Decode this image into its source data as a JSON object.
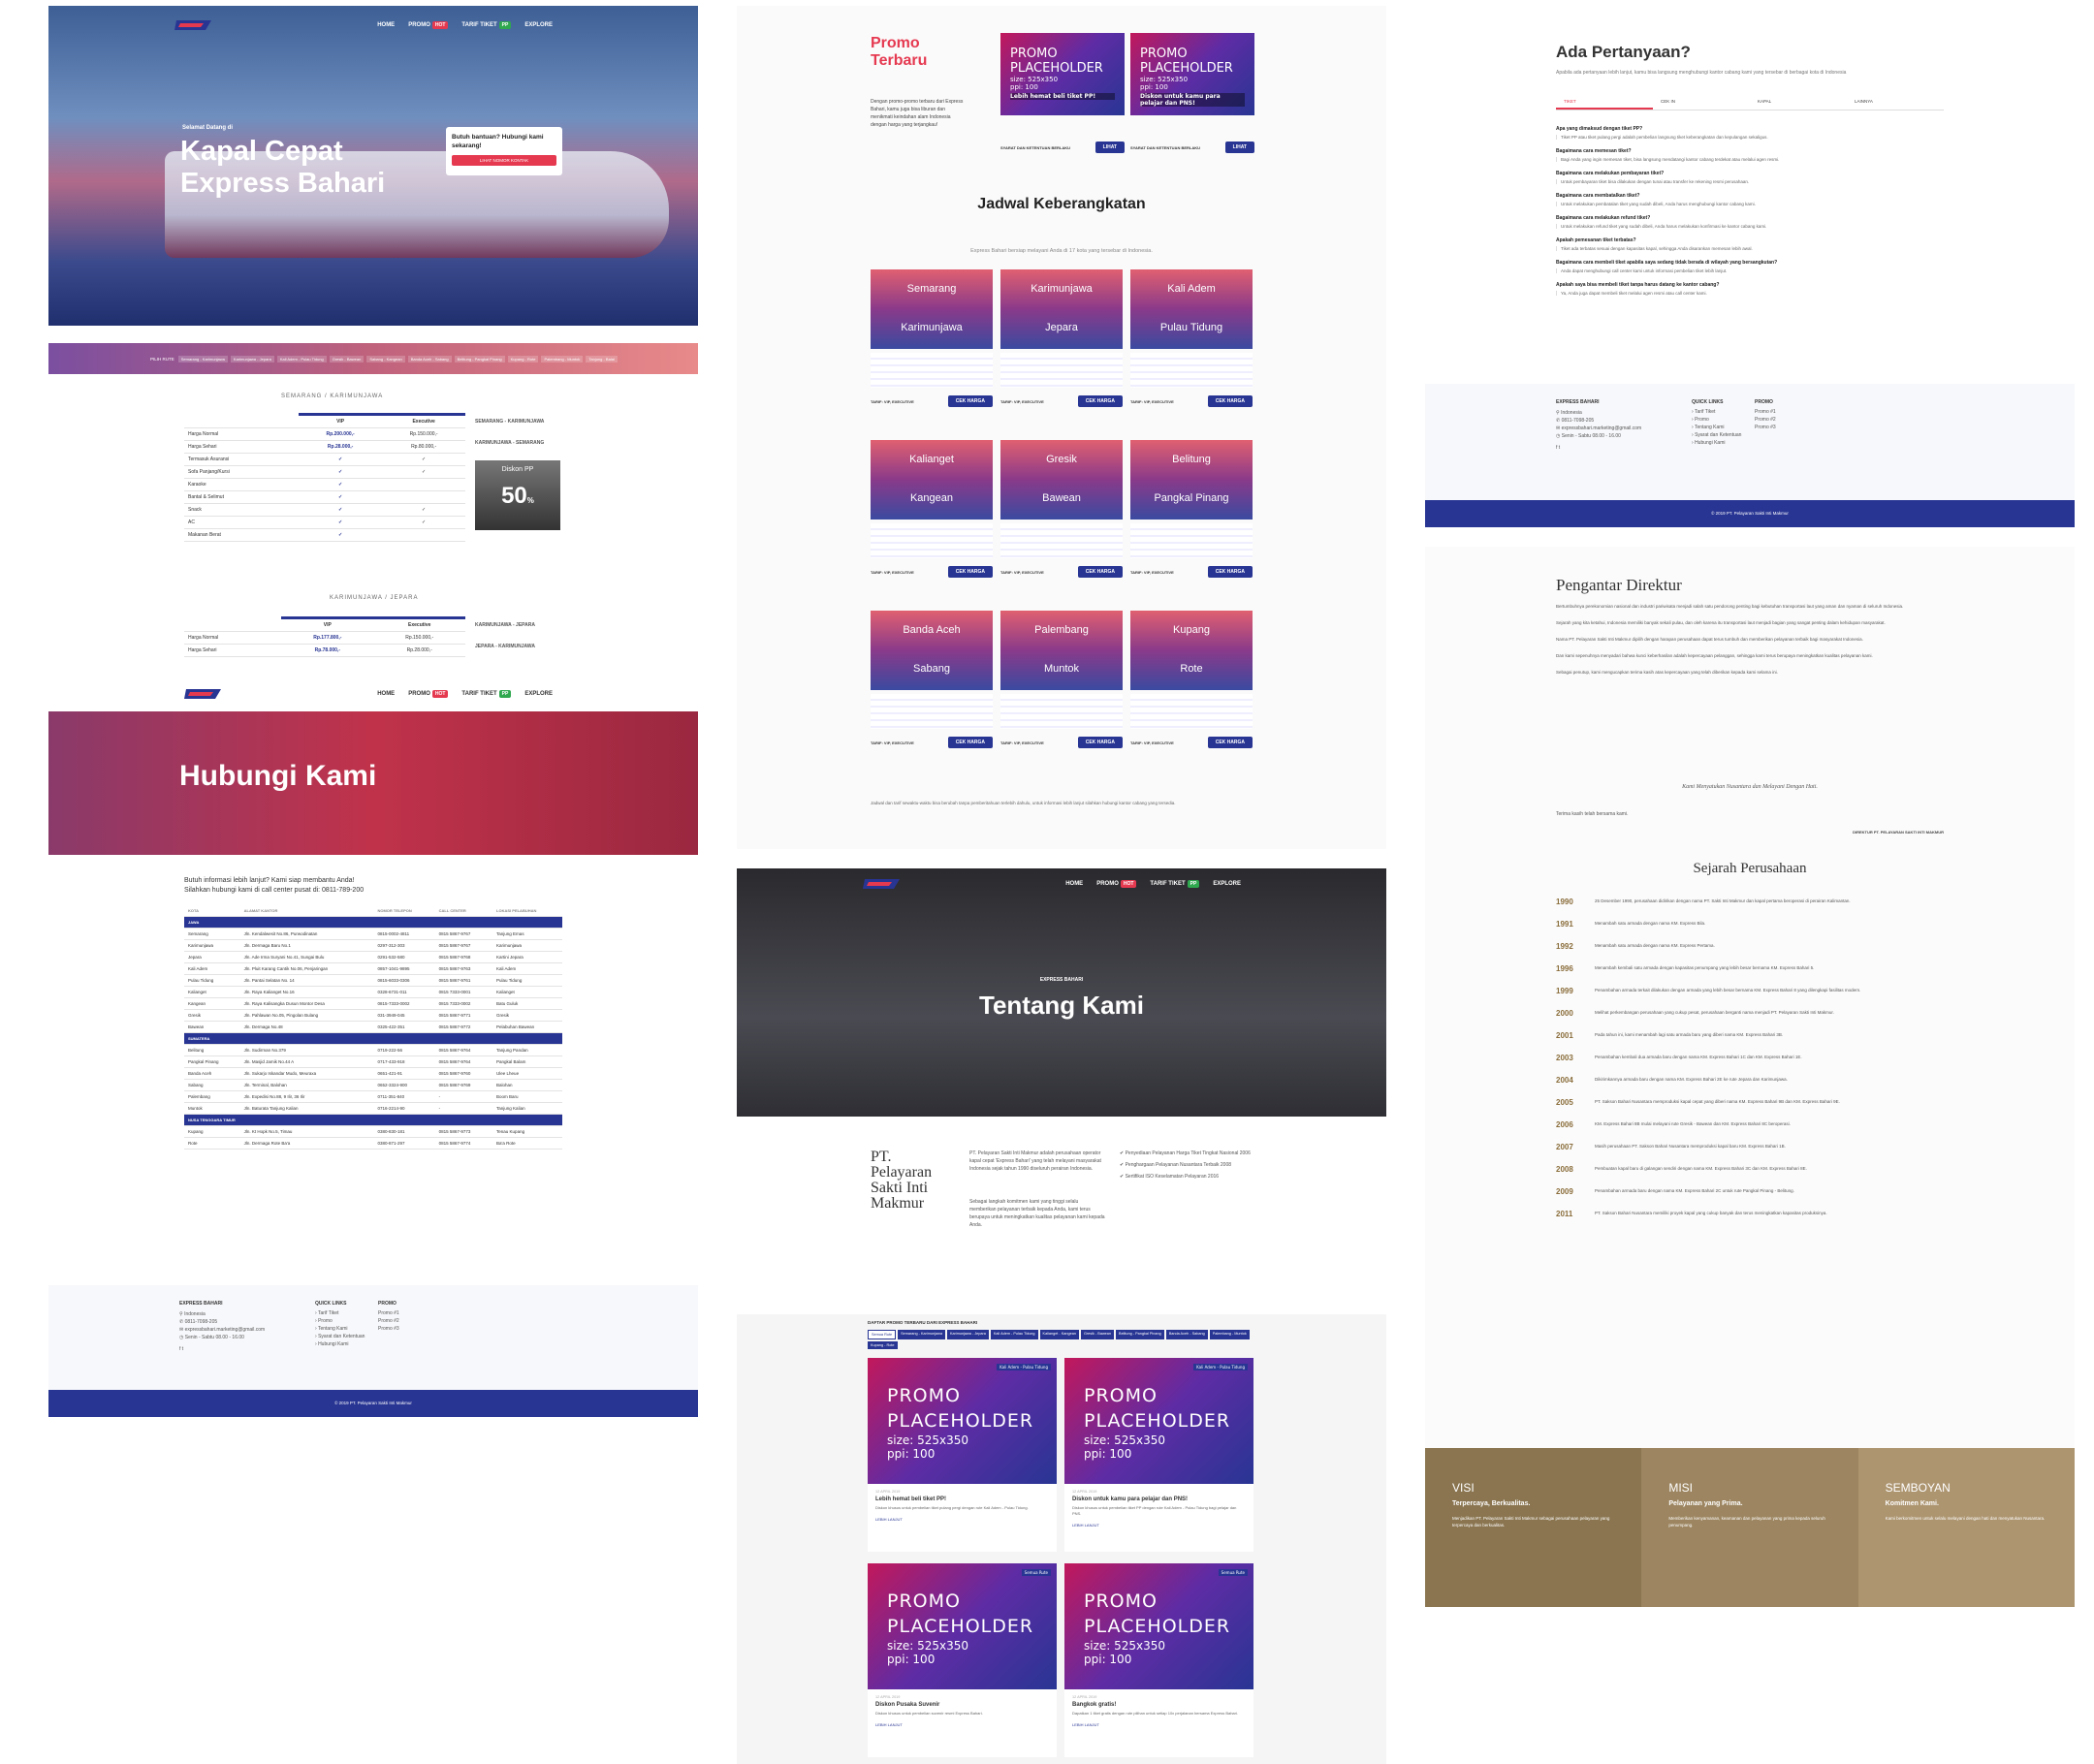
{
  "nav": {
    "home": "HOME",
    "promo": "PROMO",
    "promo_badge": "HOT",
    "tarif": "TARIF TIKET",
    "tarif_badge": "PP",
    "explore": "EXPLORE"
  },
  "hero": {
    "welcome": "Selamat Datang di",
    "title_l1": "Kapal Cepat",
    "title_l2": "Express Bahari",
    "help_title": "Butuh bantuan? Hubungi kami sekarang!",
    "help_button": "LIHAT NOMOR KONTAK"
  },
  "tarif": {
    "filter_label": "PILIH RUTE",
    "route_tabs": [
      "Semarang - Karimunjawa",
      "Karimunjawa - Jepara",
      "Kali Adem - Pulau Tidung",
      "Gresik - Bawean",
      "Sabang - Kangean",
      "Banda Aceh - Sabang",
      "Belitung - Pangkal Pinang",
      "Kupang - Rote",
      "Palembang - Muntok",
      "Tanjung - Balai"
    ],
    "route1_title": "SEMARANG / KARIMUNJAWA",
    "route2_title": "KARIMUNJAWA / JEPARA",
    "col_vip": "VIP",
    "col_exec": "Executive",
    "rows": [
      {
        "label": "Harga Normal",
        "vip": "Rp.200.000,-",
        "exec": "Rp.150.000,-"
      },
      {
        "label": "Harga Sehari",
        "vip": "Rp.28.000,-",
        "exec": "Rp.80.000,-"
      },
      {
        "label": "Termasuk Asuransi",
        "vip": "✓",
        "exec": "✓"
      },
      {
        "label": "Sofa Panjang/Kursi",
        "vip": "✓",
        "exec": "✓"
      },
      {
        "label": "Karaoke",
        "vip": "✓",
        "exec": ""
      },
      {
        "label": "Bantal & Selimut",
        "vip": "✓",
        "exec": ""
      },
      {
        "label": "Snack",
        "vip": "✓",
        "exec": "✓"
      },
      {
        "label": "AC",
        "vip": "✓",
        "exec": "✓"
      },
      {
        "label": "Makanan Berat",
        "vip": "✓",
        "exec": ""
      }
    ],
    "rows2": [
      {
        "label": "Harga Normal",
        "vip": "Rp.177.800,-",
        "exec": "Rp.150.000,-"
      },
      {
        "label": "Harga Sehari",
        "vip": "Rp.78.000,-",
        "exec": "Rp.28.000,-"
      }
    ],
    "side_sched1": "SEMARANG - KARIMUNJAWA",
    "side_sched2": "KARIMUNJAWA - SEMARANG",
    "side_sched3": "KARIMUNJAWA - JEPARA",
    "side_sched4": "JEPARA - KARIMUNJAWA",
    "diskon_title": "Diskon PP",
    "diskon_value": "50",
    "diskon_unit": "%"
  },
  "contact": {
    "title": "Hubungi Kami",
    "intro_l1": "Butuh informasi lebih lanjut? Kami siap membantu Anda!",
    "intro_l2": "Silahkan hubungi kami di call center pusat di: 0811-789-200",
    "headers": [
      "KOTA",
      "ALAMAT KANTOR",
      "NOMOR TELEPON",
      "CALL CENTER",
      "LOKASI PELABUHAN"
    ],
    "group1": "JAWA",
    "group2": "SUMATERA",
    "group3": "NUSA TENGGARA TIMUR",
    "rows_jawa": [
      [
        "Semarang",
        "Jln. Kendalwesit No.86, Purwodinatan",
        "0815-0002-4811",
        "0815 5867-9767",
        "Tanjung Emas"
      ],
      [
        "Karimunjawa",
        "Jln. Dermaga Baru No.1",
        "0297-312-303",
        "0815 5867-9767",
        "Karimunjawa"
      ],
      [
        "Jepara",
        "Jln. Ade Irma Suryani No.41, Sungai Bulu",
        "0291-532-580",
        "0815 5867-9768",
        "Kartini Jepara"
      ],
      [
        "Kali Adem",
        "Jln. Pluit Karang Cantik No.06, Penjaringan",
        "0857-1041-9895",
        "0815 5867-9763",
        "Kali Adem"
      ],
      [
        "Pulau Tidung",
        "Jln. Pantai Selatan No. 14",
        "0815-6033-0306",
        "0815 5867-9761",
        "Pulau Tidung"
      ],
      [
        "Kalianget",
        "Jln. Raya Kalianget No.16",
        "0328-6731-011",
        "0815 7333-0001",
        "Kalianget"
      ],
      [
        "Kangean",
        "Jln. Raya Kalisangka Dusun Montor Desa",
        "0815-7333-0002",
        "0815 7333-0002",
        "Batu Guluk"
      ],
      [
        "Gresik",
        "Jln. Pahlawan No.05, Pingolan Bulang",
        "031-3949-045",
        "0815 5867-9771",
        "Gresik"
      ],
      [
        "Bawean",
        "Jln. Dermaga No.48",
        "0325-422-351",
        "0815 5867-9772",
        "Pelabuhan Bawean"
      ]
    ],
    "rows_sumatera": [
      [
        "Belitung",
        "Jln. Sudirman No.379",
        "0719-222-56",
        "0815 5867-9764",
        "Tanjung Pandan"
      ],
      [
        "Pangkal Pinang",
        "Jln. Masjid Jamik No.44 A",
        "0717-433-918",
        "0815 5867-9764",
        "Pangkal Balam"
      ],
      [
        "Banda Aceh",
        "Jln. Sukarjo Iskandar Mudo, Meuraxa",
        "0651-421-91",
        "0815 5867-9760",
        "Ulee Lheue"
      ],
      [
        "Sabang",
        "Jln. Terminal, Balohan",
        "0652-3324-900",
        "0815 5867-9769",
        "Balohan"
      ],
      [
        "Palembang",
        "Jln. Expedisi No.88, 9 Ilir, 36 Ilir",
        "0711-351-840",
        "-",
        "Boom Baru"
      ],
      [
        "Muntok",
        "Jln. Baturata Tanjung Kalian",
        "0716-2214-90",
        "-",
        "Tanjung Kalian"
      ]
    ],
    "rows_ntt": [
      [
        "Kupang",
        "Jln. Kt Hopk No.5, Timau",
        "0380-830-181",
        "0815 5867-9773",
        "Tenau Kupang"
      ],
      [
        "Rote",
        "Jln. Dermaga Rote Ba'a",
        "0380-871-297",
        "0815 5867-9774",
        "Ba'a Rote"
      ]
    ]
  },
  "footer": {
    "brand": "EXPRESS BAHARI",
    "addr": "Indonesia",
    "phone": "0811-7098-205",
    "email": "expressbahari.marketing@gmail.com",
    "hours": "Senin - Sabtu 08.00 - 16.00",
    "quick_title": "QUICK LINKS",
    "quick_links": [
      "Tarif Tiket",
      "Promo",
      "Tentang Kami",
      "Syarat dan Ketentuan",
      "Hubungi Kami"
    ],
    "promo_title": "PROMO",
    "promo_items": [
      "Promo #1",
      "Promo #2",
      "Promo #3"
    ],
    "copyright": "© 2019 PT. Pelayaran Sakti Inti Makmur"
  },
  "promo_section": {
    "title_l1": "Promo",
    "title_l2": "Terbaru",
    "desc": "Dengan promo-promo terbaru dari Express Bahari, kamu juga bisa liburan dan menikmati keindahan alam Indonesia dengan harga yang terjangkau!",
    "card1_caption": "Lebih hemat beli tiket PP!",
    "card2_caption": "Diskon untuk kamu para pelajar dan PNS!",
    "card_syarat": "SYARAT DAN KETENTUAN BERLAKU",
    "card_btn": "LIHAT"
  },
  "placeholder": {
    "l1": "PROMO",
    "l2": "PLACEHOLDER",
    "l3": "size: 525x350",
    "l4": "ppi: 100"
  },
  "jadwal": {
    "title": "Jadwal Keberangkatan",
    "subtitle": "Express Bahari bersiap melayani Anda di 17 kota yang tersebar di Indonesia.",
    "cek": "CEK HARGA",
    "tarif_label": "TARIF: VIP, EXECUTIVE",
    "routes": [
      [
        "Semarang",
        "Karimunjawa"
      ],
      [
        "Karimunjawa",
        "Jepara"
      ],
      [
        "Kali Adem",
        "Pulau Tidung"
      ],
      [
        "Kalianget",
        "Kangean"
      ],
      [
        "Gresik",
        "Bawean"
      ],
      [
        "Belitung",
        "Pangkal Pinang"
      ],
      [
        "Banda Aceh",
        "Sabang"
      ],
      [
        "Palembang",
        "Muntok"
      ],
      [
        "Kupang",
        "Rote"
      ]
    ],
    "note": "Jadwal dan tarif sewaktu-waktu bisa berubah tanpa pemberitahuan terlebih dahulu, untuk informasi lebih lanjut silahkan hubungi kantor cabang yang tersedia."
  },
  "tentang": {
    "small": "EXPRESS BAHARI",
    "title": "Tentang Kami",
    "company": "PT. Pelayaran Sakti Inti Makmur",
    "p1": "PT. Pelayaran Sakti Inti Makmur adalah perusahaan operator kapal cepat 'Express Bahari' yang telah melayani masyarakat Indonesia sejak tahun 1990 diseluruh perairan Indonesia.",
    "p2": "Sebagai langkah komitmen kami yang tinggi selalu memberikan pelayanan terbaik kepada Anda, kami terus berupaya untuk meningkatkan kualitas pelayanan kami kepada Anda.",
    "bullets": [
      "Penyediaan Pelayanan Harga Tiket Tingkat Nasional 2006",
      "Penghargaan Pelayanan Nusantara Terbaik 2008",
      "Sertifikat ISO Keselamatan Pelayaran 2016"
    ]
  },
  "promo_list": {
    "filter_title": "DAFTAR PROMO TERBARU DARI EXPRESS BAHARI",
    "tabs": [
      "Semua Rute",
      "Semarang - Karimunjawa",
      "Karimunjawa - Jepara",
      "Kali Adem - Pulau Tidung",
      "Kalianget - Kangean",
      "Gresik - Bawean",
      "Belitung - Pangkal Pinang",
      "Banda Aceh - Sabang",
      "Palembang - Muntok",
      "Kupang - Rote"
    ],
    "cards": [
      {
        "tag": "Kali Adem - Pulau Tidung",
        "date": "12 APRIL 2019",
        "title": "Lebih hemat beli tiket PP!",
        "desc": "Diskon khusus untuk pembelian tiket pulang pergi dengan rute Kali Adem - Pulau Tidung.",
        "more": "LEBIH LANJUT"
      },
      {
        "tag": "Kali Adem - Pulau Tidung",
        "date": "12 APRIL 2019",
        "title": "Diskon untuk kamu para pelajar dan PNS!",
        "desc": "Diskon khusus untuk pembelian tiket PP dengan rute Kali Adem - Pulau Tidung bagi pelajar dan PNS.",
        "more": "LEBIH LANJUT"
      },
      {
        "tag": "Semua Rute",
        "date": "12 APRIL 2019",
        "title": "Diskon Pusaka Suvenir",
        "desc": "Diskon khusus untuk pembelian suvenir resmi Express Bahari.",
        "more": "LEBIH LANJUT"
      },
      {
        "tag": "Semua Rute",
        "date": "12 APRIL 2019",
        "title": "Bangkok gratis!",
        "desc": "Dapatkan 1 tiket gratis dengan rute pilihan untuk setiap 10x perjalanan bersama Express Bahari.",
        "more": "LEBIH LANJUT"
      }
    ]
  },
  "faq": {
    "title": "Ada Pertanyaan?",
    "subtitle": "Apabila ada pertanyaan lebih lanjut, kamu bisa langsung menghubungi kantor cabang kami yang tersebar di berbagai kota di Indonesia",
    "tabs": [
      "TIKET",
      "CEK IN",
      "KAPAL",
      "LAINNYA"
    ],
    "items": [
      {
        "q": "Apa yang dimaksud dengan tiket PP?",
        "a": "Tiket PP atau tiket pulang pergi adalah pembelian langsung tiket keberangkatan dan kepulangan sekaligus."
      },
      {
        "q": "Bagaimana cara memesan tiket?",
        "a": "Bagi Anda yang ingin memesan tiket, bisa langsung mendatangi kantor cabang terdekat atau melalui agen resmi."
      },
      {
        "q": "Bagaimana cara melakukan pembayaran tiket?",
        "a": "Untuk pembayaran tiket bisa dilakukan dengan tunai atau transfer ke rekening resmi perusahaan."
      },
      {
        "q": "Bagaimana cara membatalkan tiket?",
        "a": "Untuk melakukan pembatalan tiket yang sudah dibeli, Anda harus menghubungi kantor cabang kami."
      },
      {
        "q": "Bagaimana cara melakukan refund tiket?",
        "a": "Untuk melakukan refund tiket yang sudah dibeli, Anda harus melakukan konfirmasi ke kantor cabang kami."
      },
      {
        "q": "Apakah pemesanan tiket terbatas?",
        "a": "Tiket ada terbatas sesuai dengan kapasitas kapal, sehingga Anda disarankan memesan lebih awal."
      },
      {
        "q": "Bagaimana cara membeli tiket apabila saya sedang tidak berada di wilayah yang bersangkutan?",
        "a": "Anda dapat menghubungi call center kami untuk informasi pembelian tiket lebih lanjut."
      },
      {
        "q": "Apakah saya bisa membeli tiket tanpa harus datang ke kantor cabang?",
        "a": "Ya, Anda juga dapat membeli tiket melalui agen resmi atau call center kami."
      }
    ]
  },
  "direktur": {
    "title": "Pengantar Direktur",
    "paragraphs": [
      "Bertumbuhnya perekonomian nasional dan industri pariwisata menjadi salah satu pendorong penting bagi kebutuhan transportasi laut yang aman dan nyaman di seluruh Indonesia.",
      "Sejarah yang kita ketahui, Indonesia memiliki banyak sekali pulau, dan oleh karena itu transportasi laut menjadi bagian yang sangat penting dalam kehidupan masyarakat.",
      "Nama PT. Pelayaran Sakti Inti Makmur dipilih dengan harapan perusahaan dapat terus tumbuh dan memberikan pelayanan terbaik bagi masyarakat Indonesia.",
      "Dan kami sepenuhnya menyadari bahwa kunci keberhasilan adalah kepercayaan pelanggan, sehingga kami terus berupaya meningkatkan kualitas pelayanan kami.",
      "Sebagai penutup, kami mengucapkan terima kasih atas kepercayaan yang telah diberikan kepada kami selama ini."
    ],
    "quote": "Kami Menyatukan Nusantara dan Melayani Dengan Hati.",
    "closing": "Terima kasih telah bersama kami.",
    "sign": "DIREKTUR PT. PELAYARAN SAKTI INTI MAKMUR"
  },
  "sejarah": {
    "title": "Sejarah Perusahaan",
    "items": [
      {
        "year": "1990",
        "text": "25 Desember 1990, perusahaan didirikan dengan nama PT. Sakti Inti Makmur dan kapal pertama beroperasi di perairan Kalimantan."
      },
      {
        "year": "1991",
        "text": "Menambah satu armada dengan nama KM. Express Bila."
      },
      {
        "year": "1992",
        "text": "Menambah satu armada dengan nama KM. Express Pertama."
      },
      {
        "year": "1996",
        "text": "Menambah kembali satu armada dengan kapasitas penumpang yang lebih besar bernama KM. Express Bahari 5."
      },
      {
        "year": "1999",
        "text": "Penambahan armada terkait dilakukan dengan armada yang lebih besar bernama KM. Express Bahari 8 yang dilengkapi fasilitas modern."
      },
      {
        "year": "2000",
        "text": "Melihat perkembangan perusahaan yang cukup pesat, perusahaan berganti nama menjadi PT. Pelayaran Sakti Inti Makmur."
      },
      {
        "year": "2001",
        "text": "Pada tahun ini, kami menambah lagi satu armada baru yang diberi nama KM. Express Bahari 3B."
      },
      {
        "year": "2003",
        "text": "Penambahan kembali dua armada baru dengan nama KM. Express Bahari 1C dan KM. Express Bahari 1E."
      },
      {
        "year": "2004",
        "text": "Dikirimkannya armada baru dengan nama KM. Express Bahari 2E ke rute Jepara dan Karimunjawa."
      },
      {
        "year": "2005",
        "text": "PT. Sakson Bahari Nusantara memproduksi kapal cepat yang diberi nama KM. Express Bahari 9B dan KM. Express Bahari 9E."
      },
      {
        "year": "2006",
        "text": "KM. Express Bahari 8B mulai melayani rute Gresik - Bawean dan KM. Express Bahari 8C beroperasi."
      },
      {
        "year": "2007",
        "text": "Masih perusahaan PT. Sakson Bahari Nusantara memproduksi kapal baru KM. Express Bahari 1B."
      },
      {
        "year": "2008",
        "text": "Pembuatan kapal baru di galangan sendiri dengan nama KM. Express Bahari 3C dan KM. Express Bahari 8E."
      },
      {
        "year": "2009",
        "text": "Penambahan armada baru dengan nama KM. Express Bahari 2C untuk rute Pangkal Pinang - Belitung."
      },
      {
        "year": "2011",
        "text": "PT. Sakson Bahari Nusantara memiliki proyek kapal yang cukup banyak dan terus meningkatkan kapasitas produksinya."
      }
    ]
  },
  "visi": {
    "visi_t": "VISI",
    "visi_s": "Terpercaya, Berkualitas.",
    "visi_d": "Menjadikan PT. Pelayaran Sakti Inti Makmur sebagai perusahaan pelayaran yang terpercaya dan berkualitas.",
    "misi_t": "MISI",
    "misi_s": "Pelayanan yang Prima.",
    "misi_d": "Memberikan kenyamanan, keamanan dan pelayanan yang prima kepada seluruh penumpang.",
    "sem_t": "SEMBOYAN",
    "sem_s": "Komitmen Kami.",
    "sem_d": "Kami berkomitmen untuk selalu melayani dengan hati dan menyatukan Nusantara."
  }
}
